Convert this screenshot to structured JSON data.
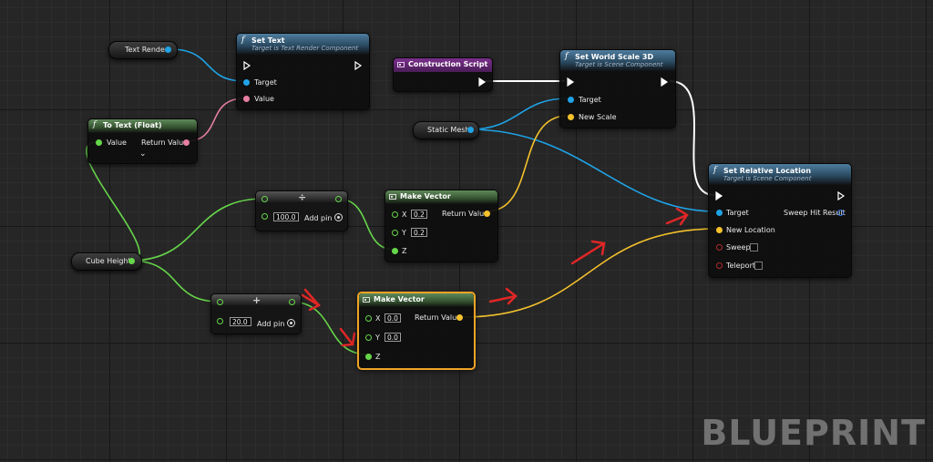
{
  "nodes": {
    "text_render": {
      "title": "Text Render"
    },
    "set_text": {
      "title": "Set Text",
      "subtitle": "Target is Text Render Component",
      "pin_target": "Target",
      "pin_value": "Value"
    },
    "to_text_float": {
      "title": "To Text (Float)",
      "pin_value": "Value",
      "pin_return": "Return Value",
      "expand_glyph": "⌄"
    },
    "construction_script": {
      "title": "Construction Script"
    },
    "set_world_scale": {
      "title": "Set World Scale 3D",
      "subtitle": "Target is Scene Component",
      "pin_target": "Target",
      "pin_new_scale": "New Scale"
    },
    "static_mesh": {
      "title": "Static Mesh"
    },
    "set_relative_location": {
      "title": "Set Relative Location",
      "subtitle": "Target is Scene Component",
      "pin_target": "Target",
      "pin_new_location": "New Location",
      "pin_sweep": "Sweep",
      "pin_teleport": "Teleport",
      "pin_sweep_hit": "Sweep Hit Result"
    },
    "divide_node": {
      "op": "÷",
      "value": "100.0",
      "add_pin": "Add pin"
    },
    "make_vector_1": {
      "title": "Make Vector",
      "x_label": "X",
      "x_value": "0.2",
      "y_label": "Y",
      "y_value": "0.2",
      "z_label": "Z",
      "return_label": "Return Value"
    },
    "cube_height": {
      "title": "Cube Height"
    },
    "add_node": {
      "op": "+",
      "value": "20.0",
      "add_pin": "Add pin"
    },
    "make_vector_2": {
      "title": "Make Vector",
      "x_label": "X",
      "x_value": "0.0",
      "y_label": "Y",
      "y_value": "0.0",
      "z_label": "Z",
      "return_label": "Return Value"
    }
  },
  "watermark": "BLUEPRINT",
  "colors": {
    "exec": "#ffffff",
    "object_pin": "#1fa3e6",
    "text_pin": "#e67fa0",
    "float_pin": "#66d64a",
    "vector_pin": "#f5c22c",
    "bool_pin": "#8f1a1a",
    "struct_pin": "#2e6fd6",
    "selection": "#f0a425",
    "annotation_arrow": "#e02626"
  }
}
